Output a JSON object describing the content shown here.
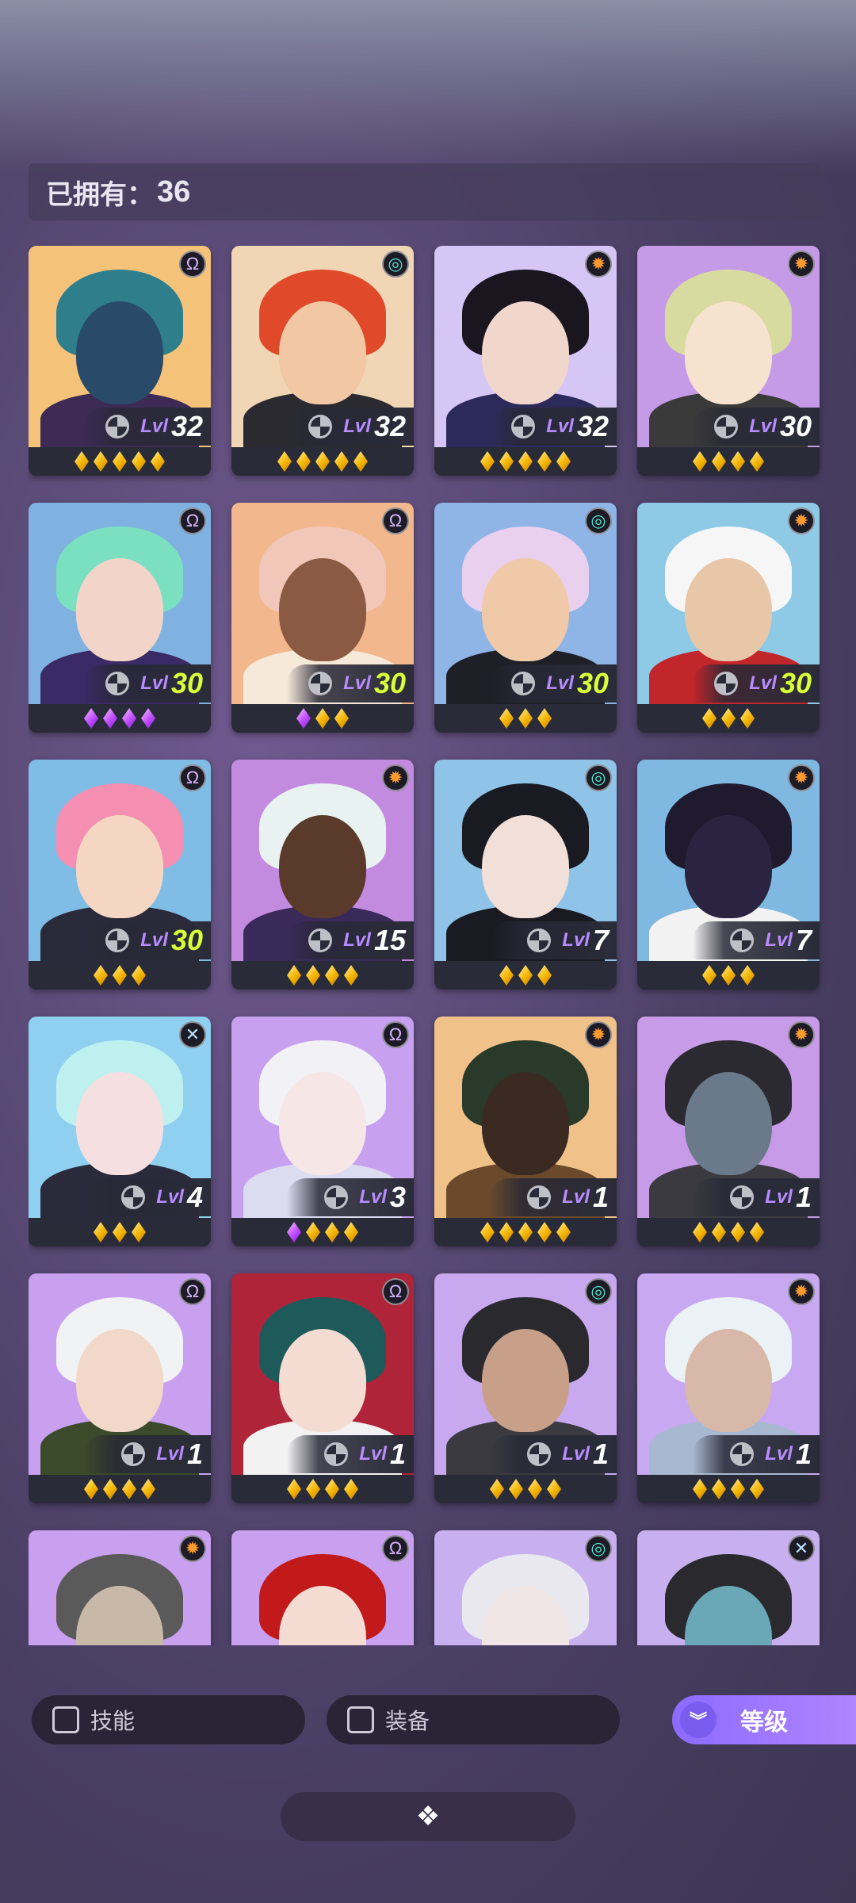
{
  "owned": {
    "label": "已拥有：",
    "count": "36"
  },
  "filters": {
    "skill_label": "技能",
    "equip_label": "装备",
    "sort_label": "等级"
  },
  "lvl_word": "Lvl",
  "cards": [
    {
      "level": "32",
      "element": "psy",
      "portrait": [
        "#f5c27a",
        "#2e7e8c",
        "#2a4a6a",
        "#3d2a55"
      ],
      "gems": [
        "gold",
        "gold",
        "gold",
        "gold",
        "gold"
      ],
      "max": false
    },
    {
      "level": "32",
      "element": "wind",
      "portrait": [
        "#f0d6b5",
        "#e04a2a",
        "#f2c7a3",
        "#2a2a30"
      ],
      "gems": [
        "gold",
        "gold",
        "gold",
        "gold",
        "gold"
      ],
      "max": false
    },
    {
      "level": "32",
      "element": "sun",
      "portrait": [
        "#d6c6f5",
        "#1a1620",
        "#f1d6cc",
        "#2c2a5a"
      ],
      "gems": [
        "gold",
        "gold",
        "gold",
        "gold",
        "gold"
      ],
      "max": false
    },
    {
      "level": "30",
      "element": "sun",
      "portrait": [
        "#c59be8",
        "#d8dba0",
        "#f7e2d0",
        "#3a3a3a"
      ],
      "gems": [
        "gold",
        "gold",
        "gold",
        "gold"
      ],
      "max": false
    },
    {
      "level": "30",
      "element": "psy",
      "portrait": [
        "#7fb2e0",
        "#7be0c0",
        "#f2d4c8",
        "#3a2a66"
      ],
      "gems": [
        "purple",
        "purple",
        "purple",
        "purple"
      ],
      "max": true
    },
    {
      "level": "30",
      "element": "psy",
      "portrait": [
        "#f2b78c",
        "#f0c7b8",
        "#8a5a42",
        "#f6e9da"
      ],
      "gems": [
        "purple",
        "gold",
        "gold"
      ],
      "max": true
    },
    {
      "level": "30",
      "element": "wind",
      "portrait": [
        "#8fb4e6",
        "#e9d0ef",
        "#f0c9a8",
        "#1f1f28"
      ],
      "gems": [
        "gold",
        "gold",
        "gold"
      ],
      "max": true
    },
    {
      "level": "30",
      "element": "sun",
      "portrait": [
        "#8ecae6",
        "#f6f6f6",
        "#e8c6a8",
        "#c0262a"
      ],
      "gems": [
        "gold",
        "gold",
        "gold"
      ],
      "max": true
    },
    {
      "level": "30",
      "element": "psy",
      "portrait": [
        "#7fbde6",
        "#f48fb1",
        "#f4d6c2",
        "#2a2a3a"
      ],
      "gems": [
        "gold",
        "gold",
        "gold"
      ],
      "max": true
    },
    {
      "level": "15",
      "element": "sun",
      "portrait": [
        "#c38be0",
        "#e8f2f0",
        "#5a3a2a",
        "#3a2a5a"
      ],
      "gems": [
        "gold",
        "gold",
        "gold",
        "gold"
      ],
      "max": false
    },
    {
      "level": "7",
      "element": "wind",
      "portrait": [
        "#8fc4e8",
        "#1a1a22",
        "#f1dfd8",
        "#1a1a22"
      ],
      "gems": [
        "gold",
        "gold",
        "gold"
      ],
      "max": false
    },
    {
      "level": "7",
      "element": "sun",
      "portrait": [
        "#7fb8e0",
        "#1f1a2e",
        "#2a2440",
        "#f2f2f2"
      ],
      "gems": [
        "gold",
        "gold",
        "gold"
      ],
      "max": false
    },
    {
      "level": "4",
      "element": "cross",
      "portrait": [
        "#8fd0f0",
        "#bff0f0",
        "#f6dfe0",
        "#2a2a3a"
      ],
      "gems": [
        "gold",
        "gold",
        "gold"
      ],
      "max": false
    },
    {
      "level": "3",
      "element": "psy",
      "portrait": [
        "#c7a0f0",
        "#f2f2f6",
        "#f6e6e6",
        "#dcdcf0"
      ],
      "gems": [
        "purple",
        "gold",
        "gold",
        "gold"
      ],
      "max": false
    },
    {
      "level": "1",
      "element": "sun",
      "portrait": [
        "#f0c28a",
        "#2a3a2a",
        "#3a2a22",
        "#6a4a2a"
      ],
      "gems": [
        "gold",
        "gold",
        "gold",
        "gold",
        "gold"
      ],
      "max": false
    },
    {
      "level": "1",
      "element": "sun",
      "portrait": [
        "#c79be8",
        "#2a2a30",
        "#6a7a8a",
        "#3a3a40"
      ],
      "gems": [
        "gold",
        "gold",
        "gold",
        "gold"
      ],
      "max": false
    },
    {
      "level": "1",
      "element": "psy",
      "portrait": [
        "#c8a0ef",
        "#f0f2f4",
        "#f2d8c8",
        "#3a4a2a"
      ],
      "gems": [
        "gold",
        "gold",
        "gold",
        "gold"
      ],
      "max": false
    },
    {
      "level": "1",
      "element": "psy",
      "portrait": [
        "#b0243a",
        "#1f5a5a",
        "#f4dcd2",
        "#f2f2f2"
      ],
      "gems": [
        "gold",
        "gold",
        "gold",
        "gold"
      ],
      "max": false
    },
    {
      "level": "1",
      "element": "wind",
      "portrait": [
        "#c8a8ef",
        "#2a2a2e",
        "#c8a08a",
        "#3a3a40"
      ],
      "gems": [
        "gold",
        "gold",
        "gold",
        "gold"
      ],
      "max": false
    },
    {
      "level": "1",
      "element": "sun",
      "portrait": [
        "#c8a8f0",
        "#eaf2f6",
        "#d8b8a8",
        "#a8b8d0"
      ],
      "gems": [
        "gold",
        "gold",
        "gold",
        "gold"
      ],
      "max": false
    },
    {
      "level": "",
      "element": "sun",
      "portrait": [
        "#c8a0ef",
        "#5a5a5a",
        "#c8b8a8",
        "#1a1a1a"
      ],
      "gems": [],
      "max": false
    },
    {
      "level": "",
      "element": "psy",
      "portrait": [
        "#c8a0ef",
        "#c21a1a",
        "#f4dcd2",
        "#2a1a1a"
      ],
      "gems": [],
      "max": false
    },
    {
      "level": "",
      "element": "wind",
      "portrait": [
        "#c8b0f0",
        "#e8e8ee",
        "#f0e6e6",
        "#cfcfe0"
      ],
      "gems": [],
      "max": false
    },
    {
      "level": "",
      "element": "cross",
      "portrait": [
        "#c8b0f0",
        "#2a2a2e",
        "#6aa8b8",
        "#1a1a1a"
      ],
      "gems": [],
      "max": false
    }
  ]
}
